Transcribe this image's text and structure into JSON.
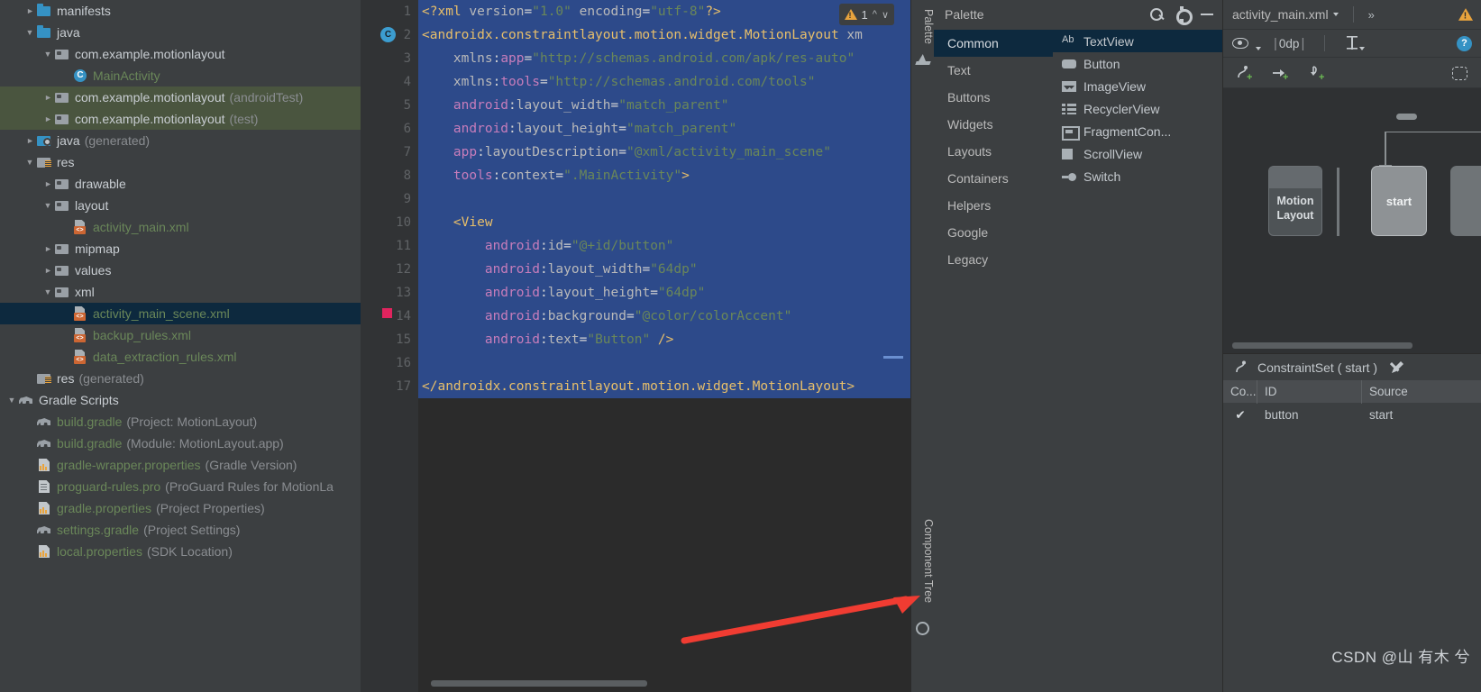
{
  "project_tree": [
    {
      "label": "manifests",
      "sub": "",
      "indent": 0,
      "arrow": "collapsed",
      "icon": "folder-blue",
      "color": "white"
    },
    {
      "label": "java",
      "sub": "",
      "indent": 0,
      "arrow": "expanded",
      "icon": "folder-blue",
      "color": "white"
    },
    {
      "label": "com.example.motionlayout",
      "sub": "",
      "indent": 1,
      "arrow": "expanded",
      "icon": "folder-grey",
      "color": "white"
    },
    {
      "label": "MainActivity",
      "sub": "",
      "indent": 2,
      "arrow": "none",
      "icon": "class",
      "color": "green"
    },
    {
      "label": "com.example.motionlayout",
      "sub": "(androidTest)",
      "indent": 1,
      "arrow": "collapsed",
      "icon": "folder-grey",
      "color": "white",
      "highlight": "test"
    },
    {
      "label": "com.example.motionlayout",
      "sub": "(test)",
      "indent": 1,
      "arrow": "collapsed",
      "icon": "folder-grey",
      "color": "white",
      "highlight": "test"
    },
    {
      "label": "java",
      "sub": "(generated)",
      "indent": 0,
      "arrow": "collapsed",
      "icon": "folder-gen",
      "color": "white"
    },
    {
      "label": "res",
      "sub": "",
      "indent": 0,
      "arrow": "expanded",
      "icon": "folder-res",
      "color": "white"
    },
    {
      "label": "drawable",
      "sub": "",
      "indent": 1,
      "arrow": "collapsed",
      "icon": "folder-grey",
      "color": "white"
    },
    {
      "label": "layout",
      "sub": "",
      "indent": 1,
      "arrow": "expanded",
      "icon": "folder-grey",
      "color": "white"
    },
    {
      "label": "activity_main.xml",
      "sub": "",
      "indent": 2,
      "arrow": "none",
      "icon": "xml",
      "color": "green"
    },
    {
      "label": "mipmap",
      "sub": "",
      "indent": 1,
      "arrow": "collapsed",
      "icon": "folder-grey",
      "color": "white"
    },
    {
      "label": "values",
      "sub": "",
      "indent": 1,
      "arrow": "collapsed",
      "icon": "folder-grey",
      "color": "white"
    },
    {
      "label": "xml",
      "sub": "",
      "indent": 1,
      "arrow": "expanded",
      "icon": "folder-grey",
      "color": "white"
    },
    {
      "label": "activity_main_scene.xml",
      "sub": "",
      "indent": 2,
      "arrow": "none",
      "icon": "xml",
      "color": "green",
      "highlight": "selected"
    },
    {
      "label": "backup_rules.xml",
      "sub": "",
      "indent": 2,
      "arrow": "none",
      "icon": "xml",
      "color": "green"
    },
    {
      "label": "data_extraction_rules.xml",
      "sub": "",
      "indent": 2,
      "arrow": "none",
      "icon": "xml",
      "color": "green"
    },
    {
      "label": "res",
      "sub": "(generated)",
      "indent": 0,
      "arrow": "none",
      "icon": "folder-res",
      "color": "white"
    },
    {
      "label": "Gradle Scripts",
      "sub": "",
      "indent": -1,
      "arrow": "expanded",
      "icon": "gradle",
      "color": "white"
    },
    {
      "label": "build.gradle",
      "sub": "(Project: MotionLayout)",
      "indent": 0,
      "arrow": "none",
      "icon": "gradle",
      "color": "green"
    },
    {
      "label": "build.gradle",
      "sub": "(Module: MotionLayout.app)",
      "indent": 0,
      "arrow": "none",
      "icon": "gradle",
      "color": "green"
    },
    {
      "label": "gradle-wrapper.properties",
      "sub": "(Gradle Version)",
      "indent": 0,
      "arrow": "none",
      "icon": "props",
      "color": "green"
    },
    {
      "label": "proguard-rules.pro",
      "sub": "(ProGuard Rules for MotionLa",
      "indent": 0,
      "arrow": "none",
      "icon": "pro",
      "color": "green"
    },
    {
      "label": "gradle.properties",
      "sub": "(Project Properties)",
      "indent": 0,
      "arrow": "none",
      "icon": "props",
      "color": "green"
    },
    {
      "label": "settings.gradle",
      "sub": "(Project Settings)",
      "indent": 0,
      "arrow": "none",
      "icon": "gradle",
      "color": "green"
    },
    {
      "label": "local.properties",
      "sub": "(SDK Location)",
      "indent": 0,
      "arrow": "none",
      "icon": "props",
      "color": "green"
    }
  ],
  "editor": {
    "warning_count": "1",
    "lines": [
      {
        "n": "1",
        "selected": true,
        "mark": "",
        "fold": "",
        "tokens": [
          {
            "t": "<?xml ",
            "c": "decl"
          },
          {
            "t": "version",
            "c": "attr"
          },
          {
            "t": "=",
            "c": "punct"
          },
          {
            "t": "\"1.0\"",
            "c": "str"
          },
          {
            "t": " encoding",
            "c": "attr"
          },
          {
            "t": "=",
            "c": "punct"
          },
          {
            "t": "\"utf-8\"",
            "c": "str"
          },
          {
            "t": "?>",
            "c": "decl"
          }
        ]
      },
      {
        "n": "2",
        "selected": true,
        "mark": "run",
        "fold": "start",
        "tokens": [
          {
            "t": "<androidx.constraintlayout.motion.widget.MotionLayout",
            "c": "tag"
          },
          {
            "t": " xm",
            "c": "attr"
          }
        ]
      },
      {
        "n": "3",
        "selected": true,
        "mark": "",
        "fold": "",
        "tokens": [
          {
            "t": "    xmlns",
            "c": "attr"
          },
          {
            "t": ":",
            "c": "punct"
          },
          {
            "t": "app",
            "c": "ns"
          },
          {
            "t": "=",
            "c": "punct"
          },
          {
            "t": "\"http://schemas.android.com/apk/res-auto\"",
            "c": "str"
          }
        ]
      },
      {
        "n": "4",
        "selected": true,
        "mark": "",
        "fold": "",
        "tokens": [
          {
            "t": "    xmlns",
            "c": "attr"
          },
          {
            "t": ":",
            "c": "punct"
          },
          {
            "t": "tools",
            "c": "ns"
          },
          {
            "t": "=",
            "c": "punct"
          },
          {
            "t": "\"http://schemas.android.com/tools\"",
            "c": "str"
          }
        ]
      },
      {
        "n": "5",
        "selected": true,
        "mark": "",
        "fold": "",
        "tokens": [
          {
            "t": "    android",
            "c": "ns"
          },
          {
            "t": ":",
            "c": "punct"
          },
          {
            "t": "layout_width",
            "c": "attr"
          },
          {
            "t": "=",
            "c": "punct"
          },
          {
            "t": "\"match_parent\"",
            "c": "str"
          }
        ]
      },
      {
        "n": "6",
        "selected": true,
        "mark": "",
        "fold": "",
        "tokens": [
          {
            "t": "    android",
            "c": "ns"
          },
          {
            "t": ":",
            "c": "punct"
          },
          {
            "t": "layout_height",
            "c": "attr"
          },
          {
            "t": "=",
            "c": "punct"
          },
          {
            "t": "\"match_parent\"",
            "c": "str"
          }
        ]
      },
      {
        "n": "7",
        "selected": true,
        "mark": "",
        "fold": "",
        "tokens": [
          {
            "t": "    app",
            "c": "ns"
          },
          {
            "t": ":",
            "c": "punct"
          },
          {
            "t": "layoutDescription",
            "c": "attr"
          },
          {
            "t": "=",
            "c": "punct"
          },
          {
            "t": "\"@xml/activity_main_scene\"",
            "c": "str"
          }
        ]
      },
      {
        "n": "8",
        "selected": true,
        "mark": "",
        "fold": "",
        "tokens": [
          {
            "t": "    tools",
            "c": "ns"
          },
          {
            "t": ":",
            "c": "punct"
          },
          {
            "t": "context",
            "c": "attr"
          },
          {
            "t": "=",
            "c": "punct"
          },
          {
            "t": "\".MainActivity\"",
            "c": "str"
          },
          {
            "t": ">",
            "c": "tag"
          }
        ]
      },
      {
        "n": "9",
        "selected": true,
        "mark": "",
        "fold": "",
        "tokens": [
          {
            "t": "",
            "c": "punct"
          }
        ]
      },
      {
        "n": "10",
        "selected": true,
        "mark": "",
        "fold": "start",
        "tokens": [
          {
            "t": "    <View",
            "c": "tag"
          }
        ]
      },
      {
        "n": "11",
        "selected": true,
        "mark": "",
        "fold": "",
        "tokens": [
          {
            "t": "        android",
            "c": "ns"
          },
          {
            "t": ":",
            "c": "punct"
          },
          {
            "t": "id",
            "c": "attr"
          },
          {
            "t": "=",
            "c": "punct"
          },
          {
            "t": "\"@+id/button\"",
            "c": "str"
          }
        ]
      },
      {
        "n": "12",
        "selected": true,
        "mark": "",
        "fold": "",
        "tokens": [
          {
            "t": "        android",
            "c": "ns"
          },
          {
            "t": ":",
            "c": "punct"
          },
          {
            "t": "layout_width",
            "c": "attr"
          },
          {
            "t": "=",
            "c": "punct"
          },
          {
            "t": "\"64dp\"",
            "c": "str"
          }
        ]
      },
      {
        "n": "13",
        "selected": true,
        "mark": "",
        "fold": "",
        "tokens": [
          {
            "t": "        android",
            "c": "ns"
          },
          {
            "t": ":",
            "c": "punct"
          },
          {
            "t": "layout_height",
            "c": "attr"
          },
          {
            "t": "=",
            "c": "punct"
          },
          {
            "t": "\"64dp\"",
            "c": "str"
          }
        ]
      },
      {
        "n": "14",
        "selected": true,
        "mark": "breakpoint",
        "fold": "",
        "tokens": [
          {
            "t": "        android",
            "c": "ns"
          },
          {
            "t": ":",
            "c": "punct"
          },
          {
            "t": "background",
            "c": "attr"
          },
          {
            "t": "=",
            "c": "punct"
          },
          {
            "t": "\"@color/colorAccent\"",
            "c": "str"
          }
        ]
      },
      {
        "n": "15",
        "selected": true,
        "mark": "",
        "fold": "end",
        "tokens": [
          {
            "t": "        android",
            "c": "ns"
          },
          {
            "t": ":",
            "c": "punct"
          },
          {
            "t": "text",
            "c": "attr"
          },
          {
            "t": "=",
            "c": "punct"
          },
          {
            "t": "\"Button\"",
            "c": "str"
          },
          {
            "t": " />",
            "c": "tag"
          }
        ]
      },
      {
        "n": "16",
        "selected": true,
        "mark": "",
        "fold": "",
        "tokens": [
          {
            "t": "",
            "c": "punct"
          }
        ]
      },
      {
        "n": "17",
        "selected": true,
        "mark": "",
        "fold": "end",
        "tokens": [
          {
            "t": "</androidx.constraintlayout.motion.widget.MotionLayout>",
            "c": "tag"
          }
        ]
      }
    ]
  },
  "tool_strip": {
    "palette_tab": "Palette",
    "component_tree_tab": "Component Tree"
  },
  "palette": {
    "title": "Palette",
    "categories": [
      {
        "label": "Common",
        "active": true
      },
      {
        "label": "Text",
        "active": false
      },
      {
        "label": "Buttons",
        "active": false
      },
      {
        "label": "Widgets",
        "active": false
      },
      {
        "label": "Layouts",
        "active": false
      },
      {
        "label": "Containers",
        "active": false
      },
      {
        "label": "Helpers",
        "active": false
      },
      {
        "label": "Google",
        "active": false
      },
      {
        "label": "Legacy",
        "active": false
      }
    ],
    "items": [
      {
        "label": "TextView",
        "icon": "ab",
        "active": true
      },
      {
        "label": "Button",
        "icon": "btn",
        "active": false
      },
      {
        "label": "ImageView",
        "icon": "img",
        "active": false
      },
      {
        "label": "RecyclerView",
        "icon": "rv",
        "active": false
      },
      {
        "label": "FragmentCon...",
        "icon": "fc",
        "active": false
      },
      {
        "label": "ScrollView",
        "icon": "sv",
        "active": false
      },
      {
        "label": "Switch",
        "icon": "sw",
        "active": false
      }
    ]
  },
  "design": {
    "file_tab": "activity_main.xml",
    "overflow": "»",
    "margin_value": "0dp",
    "help_label": "?",
    "motion_layout_label": "Motion\nLayout",
    "motion_layout_line1": "Motion",
    "motion_layout_line2": "Layout",
    "state_start": "start",
    "constraint_set_title": "ConstraintSet (  start  )",
    "table_headers": [
      "Co...",
      "ID",
      "Source"
    ],
    "table_rows": [
      {
        "constrained": "✔",
        "id": "button",
        "source": "start"
      }
    ]
  },
  "watermark": "CSDN @山 有木 兮",
  "colors": {
    "accent_blue": "#3592c4",
    "selection_blue": "#2d4a8a",
    "tree_selected": "#0d293e",
    "test_highlight": "#4a553f",
    "string_green": "#6a8759",
    "tag_yellow": "#e8bf6a",
    "ns_purple": "#c77dbb",
    "warning_amber": "#e8a33d",
    "breakpoint_pink": "#e0245e",
    "arrow_red": "#f03c32",
    "panel_bg": "#3c3f41",
    "editor_bg": "#2b2b2b"
  }
}
